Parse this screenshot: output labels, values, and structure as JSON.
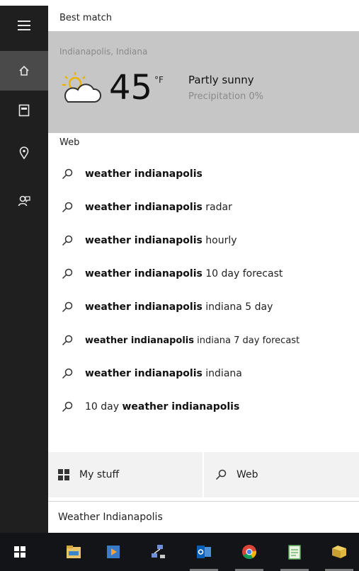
{
  "panel": {
    "best_match_label": "Best match",
    "weather": {
      "location": "Indianapolis, Indiana",
      "temperature": "45",
      "unit": "°F",
      "condition": "Partly sunny",
      "precipitation": "Precipitation 0%",
      "icon": "partly-sunny-icon"
    },
    "web_label": "Web",
    "suggestions": [
      {
        "bold": "weather indianapolis",
        "rest": ""
      },
      {
        "bold": "weather indianapolis",
        "rest": " radar"
      },
      {
        "bold": "weather indianapolis",
        "rest": " hourly"
      },
      {
        "bold": "weather indianapolis",
        "rest": " 10 day forecast"
      },
      {
        "bold": "weather indianapolis",
        "rest": " indiana 5 day"
      },
      {
        "bold": "weather indianapolis",
        "rest": " indiana 7 day forecast"
      },
      {
        "bold": "weather indianapolis",
        "rest": " indiana"
      },
      {
        "prefix": "10 day ",
        "bold": "weather indianapolis"
      }
    ]
  },
  "tabs": {
    "my_stuff_label": "My stuff",
    "web_label": "Web"
  },
  "search": {
    "value": "Weather Indianapolis"
  },
  "rail_icons": [
    "hamburger-icon",
    "home-icon",
    "notebook-icon",
    "location-pin-icon",
    "feedback-icon"
  ],
  "taskbar_icons": [
    "windows-start-icon",
    "file-explorer-icon",
    "media-player-icon",
    "network-icon",
    "outlook-icon",
    "chrome-icon",
    "notepad-icon",
    "folder-app-icon"
  ],
  "colors": {
    "rail": "#1f1f1f",
    "rail_active": "#4a4a4a",
    "weather_card": "#c6c6c6",
    "taskbar": "#121418"
  }
}
